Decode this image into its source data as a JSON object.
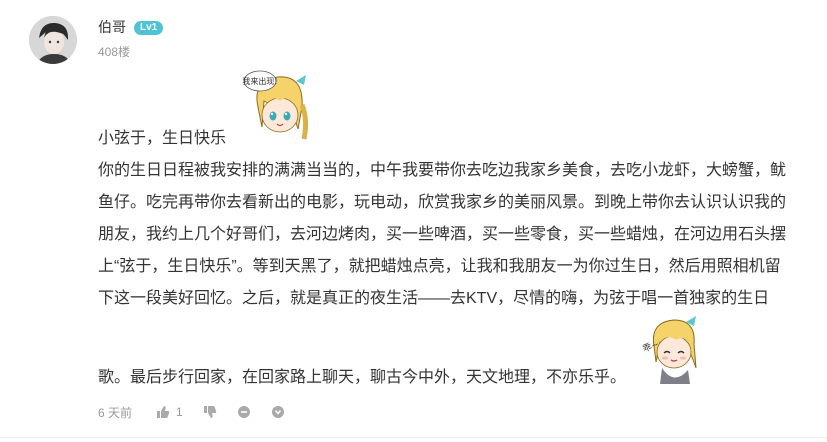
{
  "comment": {
    "username": "伯哥",
    "level": "Lv1",
    "floor": "408楼",
    "paragraphs": [
      "小弦于，生日快乐",
      "你的生日日程被我安排的满满当当的，中午我要带你去吃边我家乡美食，去吃小龙虾，大螃蟹，鱿",
      "鱼仔。吃完再带你去看新出的电影，玩电动，欣赏我家乡的美丽风景。到晚上带你去认识认识我的",
      "朋友，我约上几个好哥们，去河边烤肉，买一些啤酒，买一些零食，买一些蜡烛，在河边用石头摆",
      "上“弦于，生日快乐”。等到天黑了，就把蜡烛点亮，让我和我朋友一为你过生日，然后用照相机留",
      "下这一段美好回忆。之后，就是真正的夜生活——去KTV，尽情的嗨，为弦于唱一首独家的生日"
    ],
    "last_line": "歌。最后步行回家，在回家路上聊天，聊古今中外，天文地理，不亦乐乎。",
    "sticker1_text": "我来出现!",
    "sticker2_text": "乖~",
    "time": "6 天前",
    "like_count": "1"
  },
  "colors": {
    "badge": "#4fc3d6",
    "meta_text": "#999999",
    "body_text": "#333333"
  },
  "icons": [
    "thumbs-up-icon",
    "thumbs-down-icon",
    "comment-icon",
    "more-icon"
  ]
}
